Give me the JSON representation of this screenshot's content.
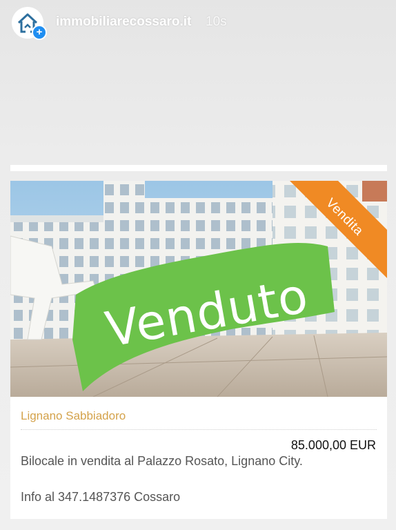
{
  "story": {
    "account_name": "immobiliarecossaro.it",
    "time_ago": "10s"
  },
  "listing": {
    "ribbon_label": "Vendita",
    "sold_label": "Venduto",
    "location": "Lignano Sabbiadoro",
    "price": "85.000,00 EUR",
    "description": "Bilocale in vendita al Palazzo Rosato, Lignano City.",
    "contact": "Info al 347.1487376 Cossaro"
  },
  "colors": {
    "ribbon": "#f08a24",
    "sold_banner": "#6cc24a",
    "location_text": "#d4a24a",
    "badge": "#1f8ef1"
  }
}
